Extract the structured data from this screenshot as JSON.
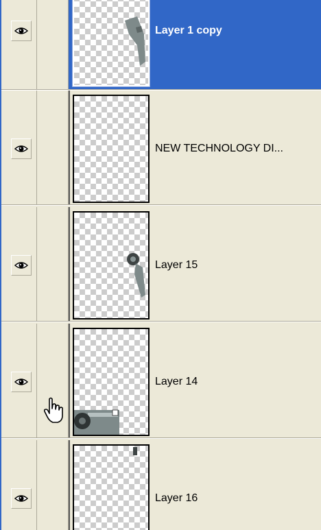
{
  "layers_panel": {
    "layers": [
      {
        "name": "Layer 1 copy",
        "selected": true,
        "visible": true,
        "column2_icon": "brush-icon"
      },
      {
        "name": "NEW TECHNOLOGY DI...",
        "selected": false,
        "visible": true,
        "column2_icon": "link-icon"
      },
      {
        "name": "Layer 15",
        "selected": false,
        "visible": true,
        "column2_icon": "link-icon"
      },
      {
        "name": "Layer 14",
        "selected": false,
        "visible": true,
        "column2_icon": "link-icon"
      },
      {
        "name": "Layer 16",
        "selected": false,
        "visible": true,
        "column2_icon": "empty"
      }
    ],
    "colors": {
      "selection": "#3167C7",
      "panel_bg": "#ECE9D8"
    }
  }
}
